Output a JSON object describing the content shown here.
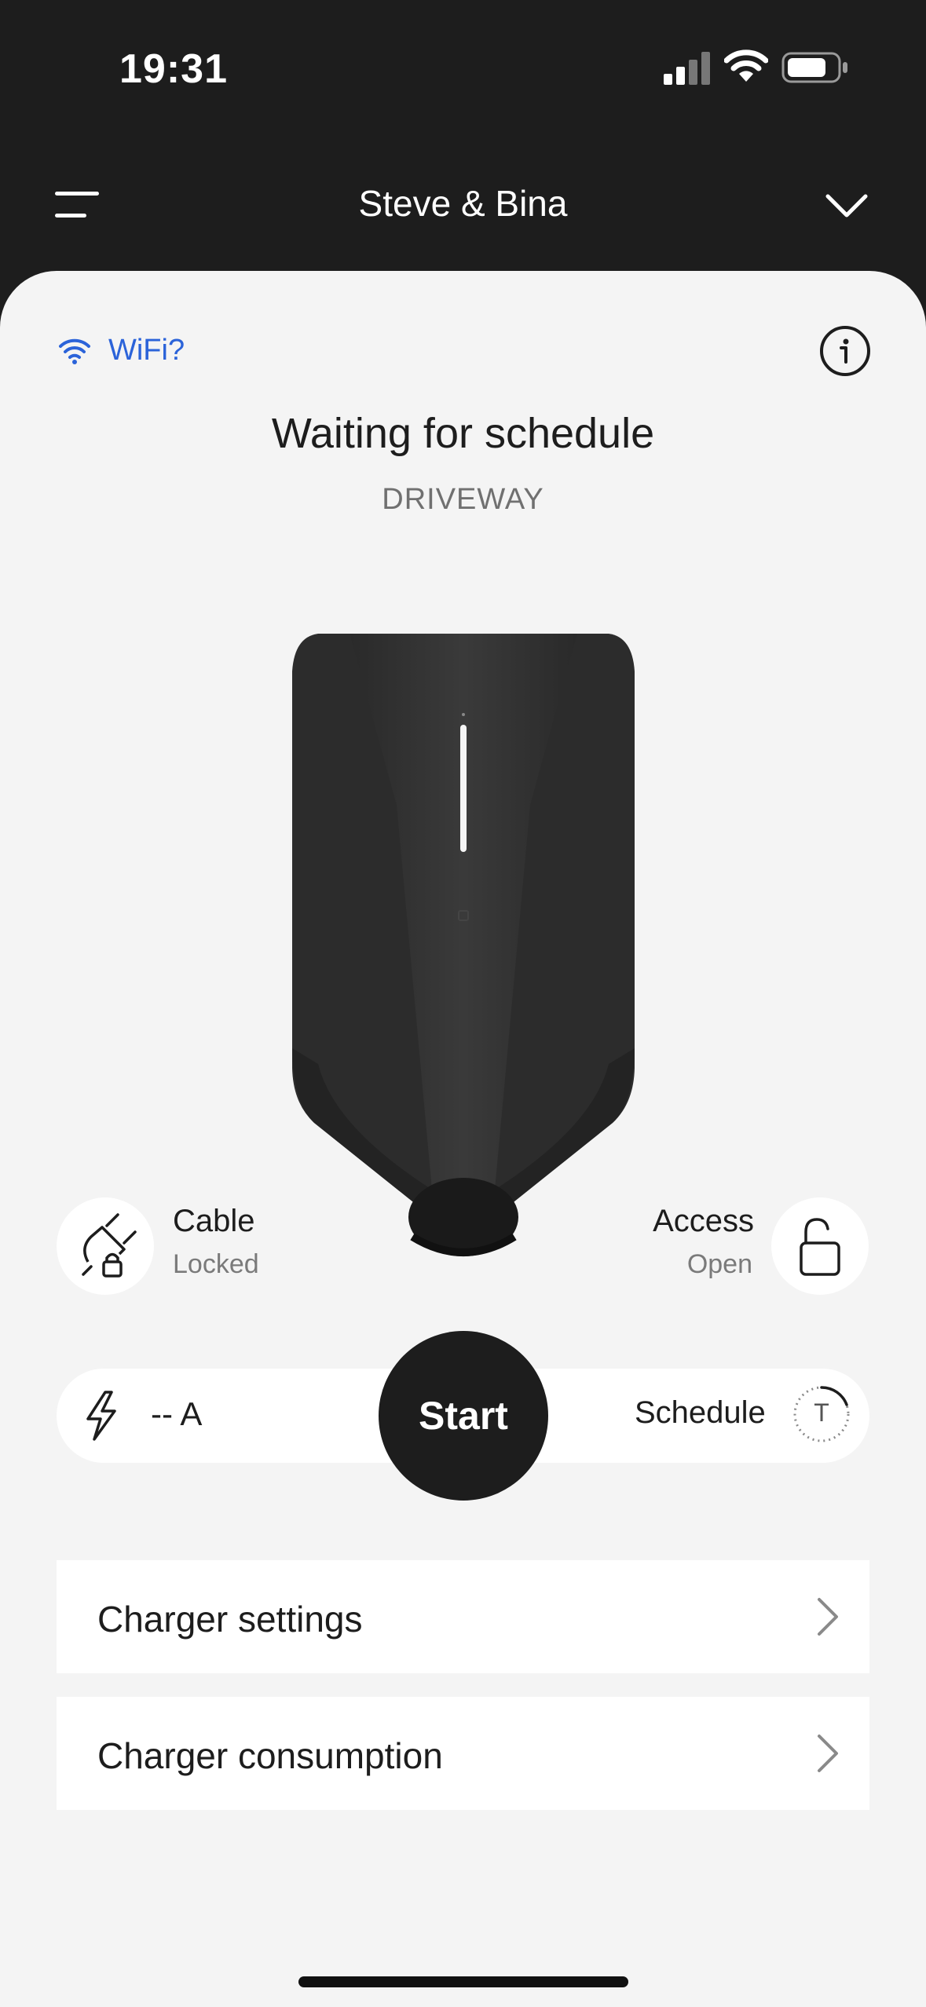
{
  "status_bar": {
    "time": "19:31"
  },
  "header": {
    "title": "Steve & Bina"
  },
  "connection": {
    "wifi_label": "WiFi?"
  },
  "charger": {
    "status": "Waiting for schedule",
    "name": "DRIVEWAY"
  },
  "cable": {
    "label": "Cable",
    "state": "Locked"
  },
  "access": {
    "label": "Access",
    "state": "Open"
  },
  "controls": {
    "current": "-- A",
    "start_label": "Start",
    "schedule_label": "Schedule",
    "schedule_icon_letter": "T"
  },
  "menu": [
    {
      "label": "Charger settings"
    },
    {
      "label": "Charger consumption"
    }
  ],
  "colors": {
    "header_bg": "#1d1d1d",
    "sheet_bg": "#f4f4f4",
    "accent_link": "#2b63d9",
    "start_button": "#1d1d1d"
  },
  "icons": {
    "signal": "cellular-signal-icon",
    "wifi": "wifi-icon",
    "battery": "battery-icon",
    "menu": "hamburger-menu-icon",
    "dropdown": "chevron-down-icon",
    "info": "info-icon",
    "cable": "plug-lock-icon",
    "access": "unlocked-padlock-icon",
    "current": "lightning-bolt-icon",
    "schedule": "schedule-timer-icon",
    "row_arrow": "chevron-right-icon"
  }
}
